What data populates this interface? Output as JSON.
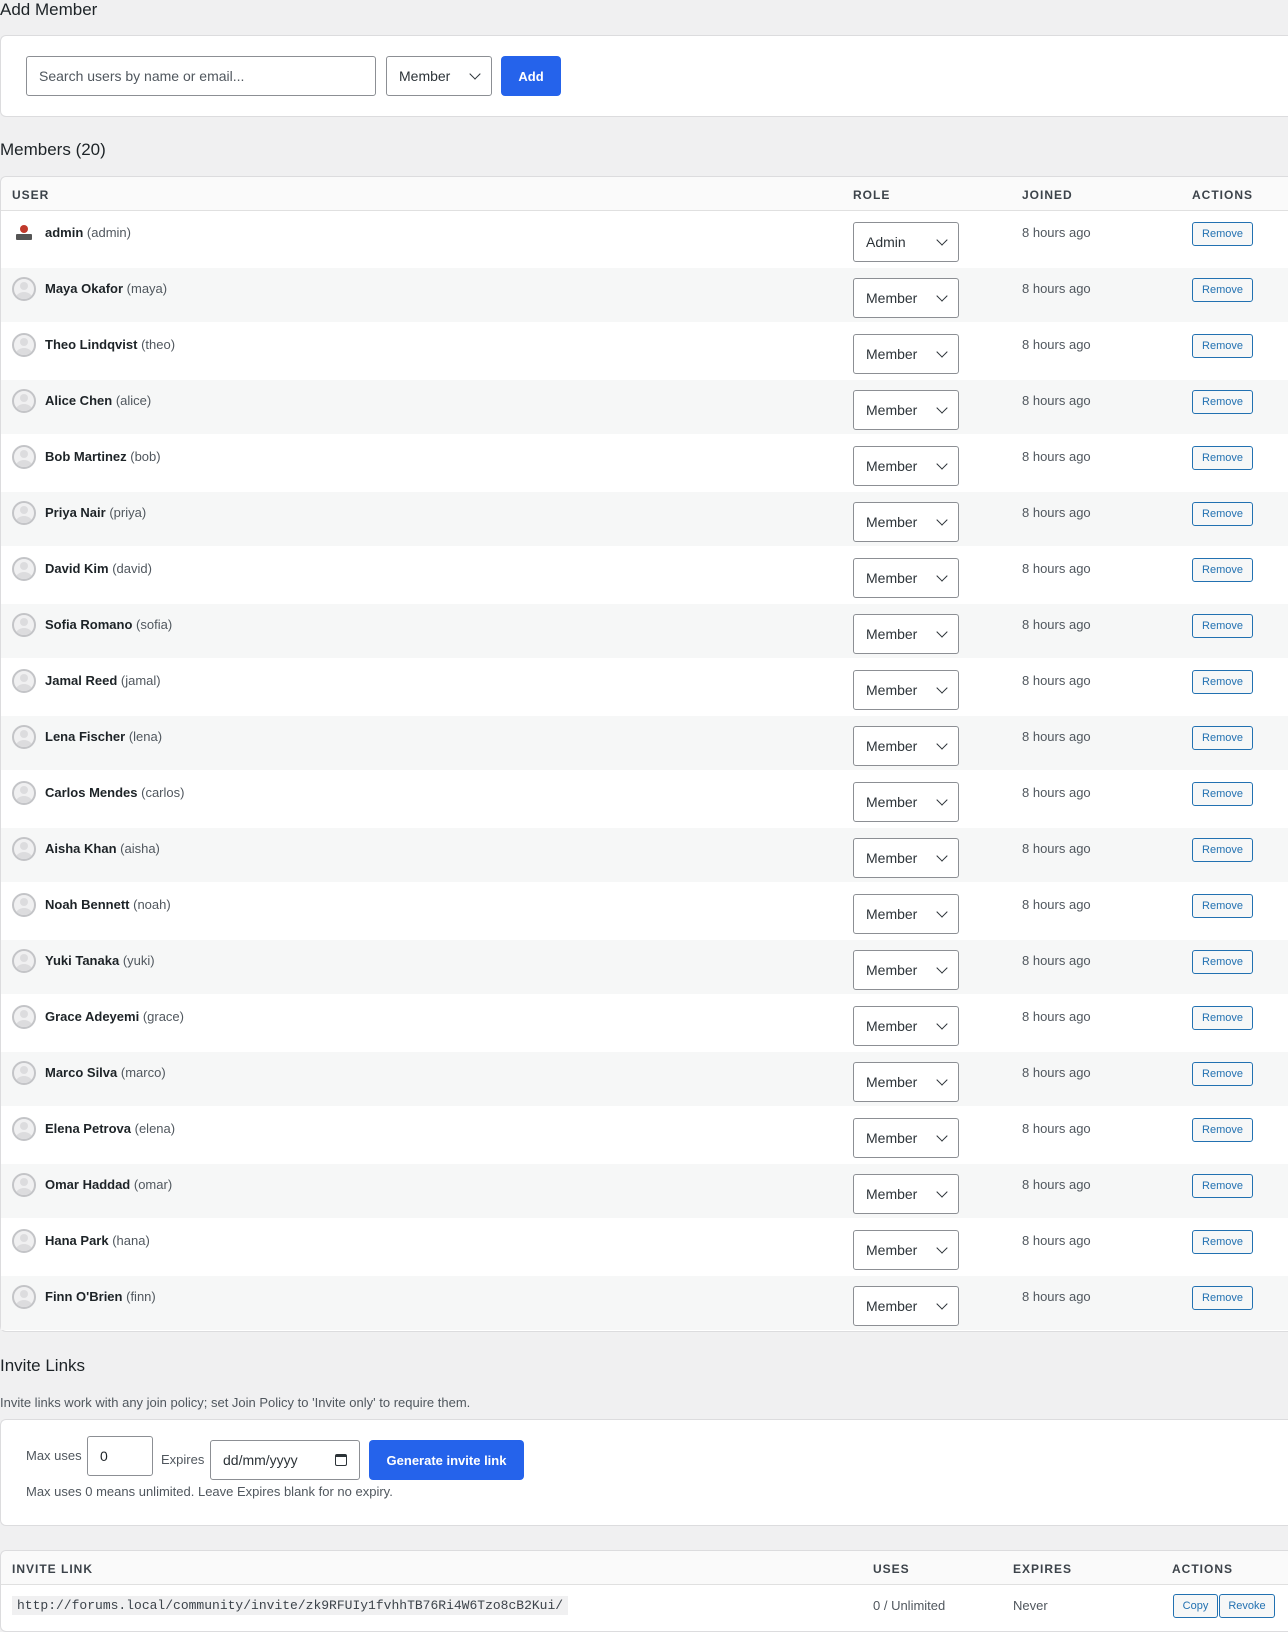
{
  "add_member": {
    "title": "Add Member",
    "search_placeholder": "Search users by name or email...",
    "role_selected": "Member",
    "add_label": "Add"
  },
  "members": {
    "title": "Members (20)",
    "columns": [
      "USER",
      "ROLE",
      "JOINED",
      "ACTIONS"
    ],
    "remove_label": "Remove",
    "rows": [
      {
        "name": "admin",
        "handle": "(admin)",
        "role": "Admin",
        "joined": "8 hours ago"
      },
      {
        "name": "Maya Okafor",
        "handle": "(maya)",
        "role": "Member",
        "joined": "8 hours ago"
      },
      {
        "name": "Theo Lindqvist",
        "handle": "(theo)",
        "role": "Member",
        "joined": "8 hours ago"
      },
      {
        "name": "Alice Chen",
        "handle": "(alice)",
        "role": "Member",
        "joined": "8 hours ago"
      },
      {
        "name": "Bob Martinez",
        "handle": "(bob)",
        "role": "Member",
        "joined": "8 hours ago"
      },
      {
        "name": "Priya Nair",
        "handle": "(priya)",
        "role": "Member",
        "joined": "8 hours ago"
      },
      {
        "name": "David Kim",
        "handle": "(david)",
        "role": "Member",
        "joined": "8 hours ago"
      },
      {
        "name": "Sofia Romano",
        "handle": "(sofia)",
        "role": "Member",
        "joined": "8 hours ago"
      },
      {
        "name": "Jamal Reed",
        "handle": "(jamal)",
        "role": "Member",
        "joined": "8 hours ago"
      },
      {
        "name": "Lena Fischer",
        "handle": "(lena)",
        "role": "Member",
        "joined": "8 hours ago"
      },
      {
        "name": "Carlos Mendes",
        "handle": "(carlos)",
        "role": "Member",
        "joined": "8 hours ago"
      },
      {
        "name": "Aisha Khan",
        "handle": "(aisha)",
        "role": "Member",
        "joined": "8 hours ago"
      },
      {
        "name": "Noah Bennett",
        "handle": "(noah)",
        "role": "Member",
        "joined": "8 hours ago"
      },
      {
        "name": "Yuki Tanaka",
        "handle": "(yuki)",
        "role": "Member",
        "joined": "8 hours ago"
      },
      {
        "name": "Grace Adeyemi",
        "handle": "(grace)",
        "role": "Member",
        "joined": "8 hours ago"
      },
      {
        "name": "Marco Silva",
        "handle": "(marco)",
        "role": "Member",
        "joined": "8 hours ago"
      },
      {
        "name": "Elena Petrova",
        "handle": "(elena)",
        "role": "Member",
        "joined": "8 hours ago"
      },
      {
        "name": "Omar Haddad",
        "handle": "(omar)",
        "role": "Member",
        "joined": "8 hours ago"
      },
      {
        "name": "Hana Park",
        "handle": "(hana)",
        "role": "Member",
        "joined": "8 hours ago"
      },
      {
        "name": "Finn O'Brien",
        "handle": "(finn)",
        "role": "Member",
        "joined": "8 hours ago"
      }
    ]
  },
  "invite": {
    "title": "Invite Links",
    "description": "Invite links work with any join policy; set Join Policy to 'Invite only' to require them.",
    "max_uses_label": "Max uses",
    "max_uses_value": "0",
    "expires_label": "Expires",
    "expires_placeholder": "dd/mm/yyyy",
    "generate_label": "Generate invite link",
    "hint": "Max uses 0 means unlimited. Leave Expires blank for no expiry.",
    "columns": [
      "INVITE LINK",
      "USES",
      "EXPIRES",
      "ACTIONS"
    ],
    "links": [
      {
        "url": "http://forums.local/community/invite/zk9RFUIy1fvhhTB76Ri4W6Tzo8cB2Kui/",
        "uses": "0 / Unlimited",
        "expires": "Never",
        "copy_label": "Copy",
        "revoke_label": "Revoke"
      }
    ]
  }
}
